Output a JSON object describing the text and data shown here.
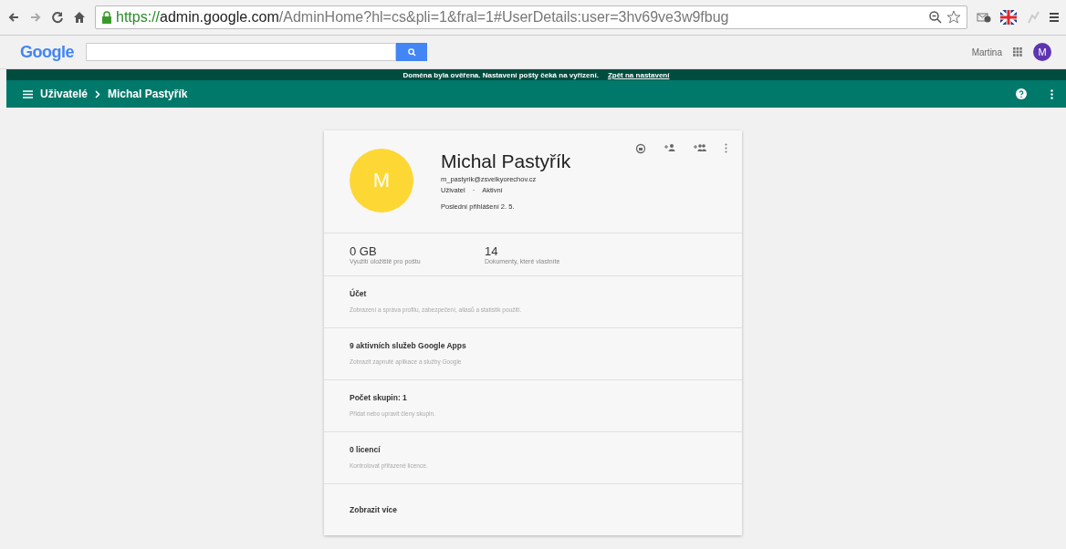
{
  "browser": {
    "url": {
      "scheme": "https://",
      "host": "admin.google.com",
      "path": "/AdminHome?hl=cs&pli=1&fral=1#UserDetails:user=3hv69ve3w9fbug"
    }
  },
  "topbar": {
    "logo": "Google",
    "user_name": "Martina",
    "avatar": "M"
  },
  "notice": {
    "text": "Doména byla ověřena. Nastavení pošty čeká na vyřízení.",
    "link": "Zpět na nastavení"
  },
  "breadcrumb": [
    "Uživatelé",
    "Michal Pastyřík"
  ],
  "user": {
    "avatar": "M",
    "name": "Michal Pastyřík",
    "email": "m_pastyrik@zsvelkyorechov.cz",
    "role": "Uživatel",
    "separator": "·",
    "status": "Aktivní",
    "last_login": "Poslední přihlášení 2. 5."
  },
  "stats": [
    {
      "value": "0 GB",
      "label": "Využití úložiště pro poštu"
    },
    {
      "value": "14",
      "label": "Dokumenty, které vlastníte"
    }
  ],
  "sections": [
    {
      "title": "Účet",
      "description": "Zobrazení a správa profilu, zabezpečení, aliasů a statistik použití."
    },
    {
      "title": "9 aktivních služeb Google Apps",
      "description": "Zobrazit zapnuté aplikace a služby Google"
    },
    {
      "title": "Počet skupin: 1",
      "description": "Přidat nebo upravit členy skupin."
    },
    {
      "title": "0 licencí",
      "description": "Kontrolovat přiřazené licence."
    },
    {
      "title": "Zobrazit více"
    }
  ]
}
